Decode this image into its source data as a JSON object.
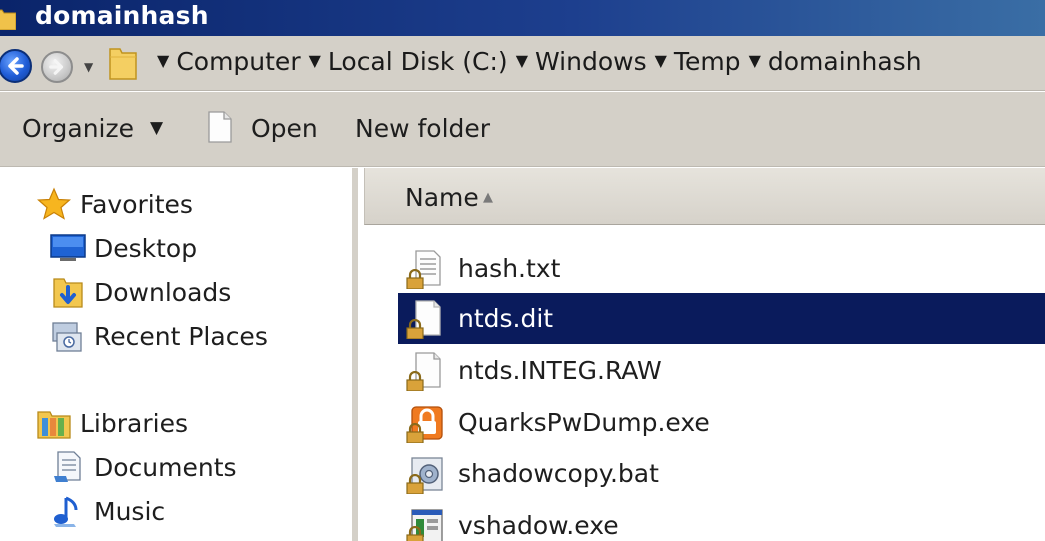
{
  "window": {
    "title": "domainhash"
  },
  "address": {
    "crumbs": [
      "Computer",
      "Local Disk (C:)",
      "Windows",
      "Temp",
      "domainhash"
    ]
  },
  "toolbar": {
    "organize": "Organize",
    "open": "Open",
    "new_folder": "New folder"
  },
  "navpane": {
    "favorites": "Favorites",
    "desktop": "Desktop",
    "downloads": "Downloads",
    "recent": "Recent Places",
    "libraries": "Libraries",
    "documents": "Documents",
    "music": "Music"
  },
  "content": {
    "column_name": "Name",
    "files": [
      {
        "name": "hash.txt",
        "icon": "text-file-icon",
        "selected": false
      },
      {
        "name": "ntds.dit",
        "icon": "file-icon",
        "selected": true
      },
      {
        "name": "ntds.INTEG.RAW",
        "icon": "file-icon",
        "selected": false
      },
      {
        "name": "QuarksPwDump.exe",
        "icon": "quarkspwdump-app-icon",
        "selected": false
      },
      {
        "name": "shadowcopy.bat",
        "icon": "batch-file-icon",
        "selected": false
      },
      {
        "name": "vshadow.exe",
        "icon": "exe-app-icon",
        "selected": false
      }
    ]
  },
  "colors": {
    "title_bar": "#0a246a",
    "selection": "#0a1b5c",
    "chrome": "#d4d0c8"
  }
}
